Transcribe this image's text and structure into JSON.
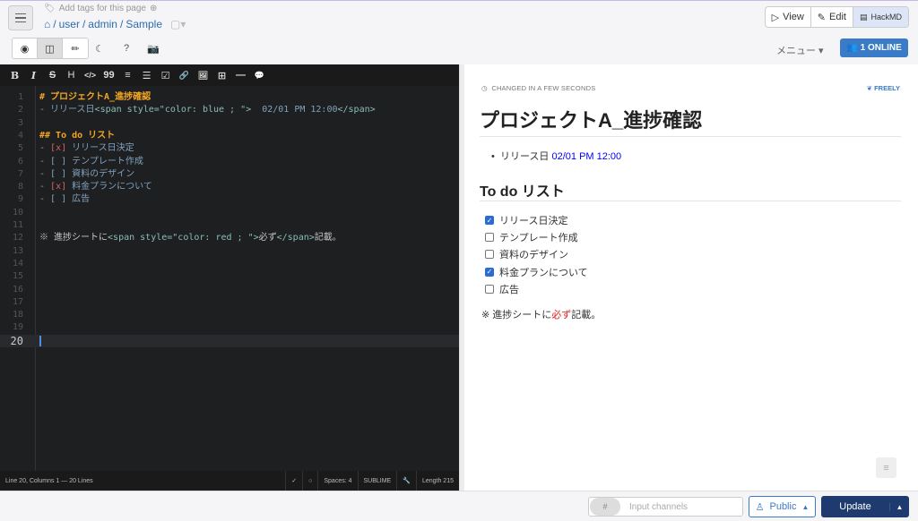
{
  "header": {
    "tags_placeholder": "Add tags for this page",
    "path": [
      "user",
      "admin",
      "Sample"
    ],
    "view_label": "View",
    "edit_label": "Edit",
    "brand": "HackMD"
  },
  "toolbar": {
    "menu_label": "メニュー",
    "online_label": "1 ONLINE"
  },
  "editor": {
    "md_tools": [
      "B",
      "I",
      "S",
      "H",
      "</>",
      "99",
      "≡",
      "☰",
      "☑",
      "🔗",
      "🖼",
      "⊞",
      "—",
      "💬"
    ],
    "lines": [
      {
        "n": "1",
        "t": "# プロジェクトA_進捗確認"
      },
      {
        "n": "2",
        "t": "- リリース日<span style=\"color: blue ; \">  02/01 PM 12:00</span>"
      },
      {
        "n": "3",
        "t": ""
      },
      {
        "n": "4",
        "t": "## To do リスト"
      },
      {
        "n": "5",
        "t": "- [x] リリース日決定"
      },
      {
        "n": "6",
        "t": "- [ ] テンプレート作成"
      },
      {
        "n": "7",
        "t": "- [ ] 資料のデザイン"
      },
      {
        "n": "8",
        "t": "- [x] 料金プランについて"
      },
      {
        "n": "9",
        "t": "- [ ] 広告"
      },
      {
        "n": "10",
        "t": ""
      },
      {
        "n": "11",
        "t": ""
      },
      {
        "n": "12",
        "t": "※ 進捗シートに<span style=\"color: red ; \">必ず</span>記載。"
      },
      {
        "n": "13",
        "t": ""
      },
      {
        "n": "14",
        "t": ""
      },
      {
        "n": "15",
        "t": ""
      },
      {
        "n": "16",
        "t": ""
      },
      {
        "n": "17",
        "t": ""
      },
      {
        "n": "18",
        "t": ""
      },
      {
        "n": "19",
        "t": ""
      },
      {
        "n": "20",
        "t": ""
      }
    ],
    "status_left": "Line 20, Columns 1 — 20 Lines",
    "spaces": "Spaces: 4",
    "keymap": "SUBLIME",
    "length": "Length 215"
  },
  "view": {
    "changed": "CHANGED IN A FEW SECONDS",
    "freely": "FREELY",
    "title": "プロジェクトA_進捗確認",
    "release_label": "リリース日",
    "release_value": "02/01 PM 12:00",
    "todo_heading": "To do リスト",
    "tasks": [
      {
        "label": "リリース日決定",
        "checked": true
      },
      {
        "label": "テンプレート作成",
        "checked": false
      },
      {
        "label": "資料のデザイン",
        "checked": false
      },
      {
        "label": "料金プランについて",
        "checked": true
      },
      {
        "label": "広告",
        "checked": false
      }
    ],
    "note_pre": "※ 進捗シートに",
    "note_red": "必ず",
    "note_post": "記載。"
  },
  "footer": {
    "channels_placeholder": "Input channels",
    "public_label": "Public",
    "update_label": "Update"
  }
}
